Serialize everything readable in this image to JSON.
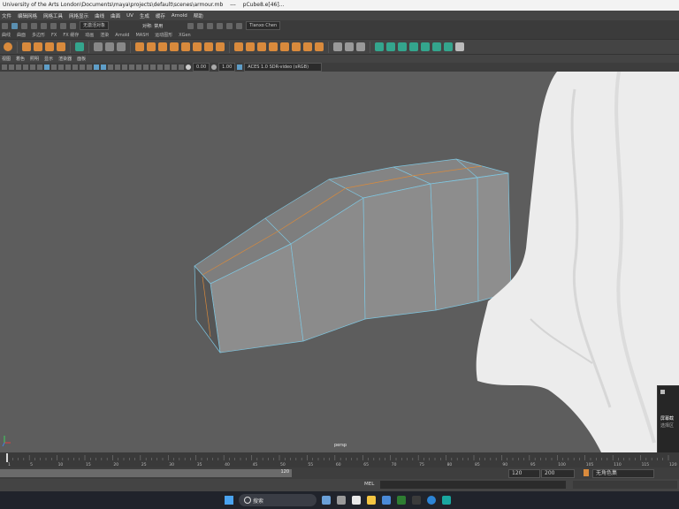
{
  "titlebar": {
    "path": "University of the Arts London\\Documents\\maya\\projects\\default\\scenes\\armour.mb",
    "separator": "---",
    "object": "pCube8.e[46]..."
  },
  "menu": [
    "文件",
    "编辑网格",
    "网格工具",
    "网格显示",
    "曲线",
    "曲面",
    "UV",
    "生成",
    "缓存",
    "Arnold",
    "帮助"
  ],
  "statusline": {
    "selection_field": "无激活对象",
    "symmetry_label": "对称: 禁用",
    "user": "Tianxo Chen"
  },
  "shelf_tabs": [
    "曲线",
    "曲面",
    "多边形",
    "FX",
    "FX 缓存",
    "动画",
    "渲染",
    "Arnold",
    "MASH",
    "运动图形",
    "XGen"
  ],
  "panel_menu": [
    "视图",
    "着色",
    "照明",
    "显示",
    "渲染器",
    "面板"
  ],
  "panel_toolbar": {
    "exposure": "0.00",
    "gamma": "1.00",
    "colorspace": "ACES 1.0 SDR-video (sRGB)"
  },
  "viewport": {
    "camera_label": "persp"
  },
  "timeline": {
    "ticks": [
      "1",
      "5",
      "10",
      "15",
      "20",
      "25",
      "30",
      "35",
      "40",
      "45",
      "50",
      "55",
      "60",
      "65",
      "70",
      "75",
      "80",
      "85",
      "90",
      "95",
      "100",
      "105",
      "110",
      "115",
      "120"
    ],
    "current_frame": "1"
  },
  "range": {
    "range_end_handle": "120",
    "anim_end": "120",
    "playback_end": "200",
    "anim_layer": "无角色集"
  },
  "cmdline": {
    "label": "MEL"
  },
  "taskbar": {
    "search_placeholder": "搜索"
  },
  "toast": {
    "line1": "屏幕截",
    "line2": "选择区"
  },
  "colors": {
    "accent": "#d98a3c",
    "shelf_teal": "#34a58d",
    "viewport_bg": "#5d5d5d"
  }
}
